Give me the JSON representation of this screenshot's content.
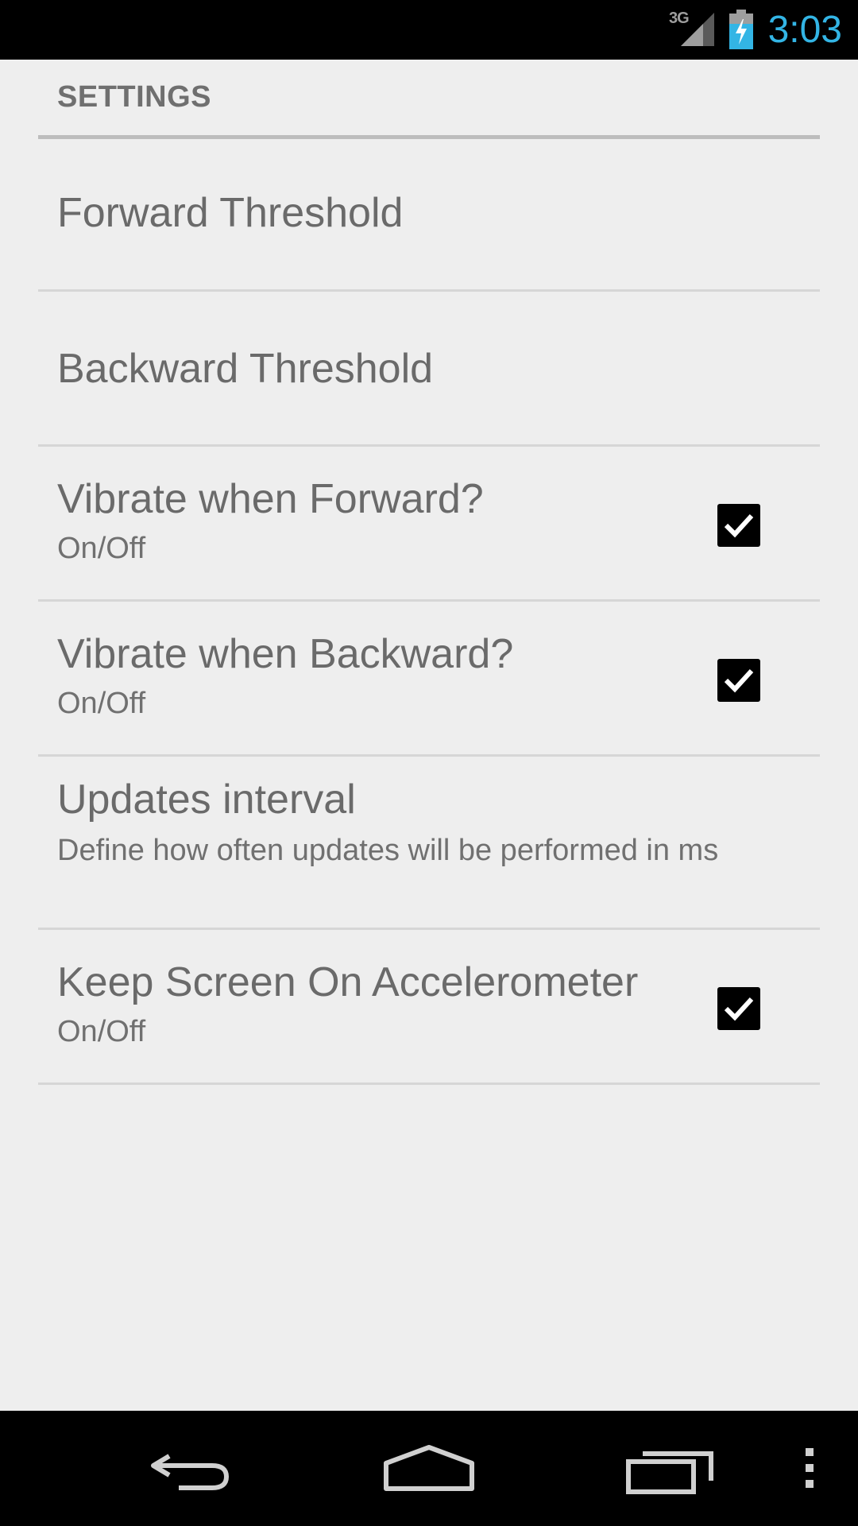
{
  "status_bar": {
    "network_type": "3G",
    "time": "3:03",
    "clock_color": "#33b5e5"
  },
  "settings": {
    "section_title": "SETTINGS",
    "items": [
      {
        "title": "Forward Threshold",
        "summary": "",
        "has_checkbox": false
      },
      {
        "title": "Backward Threshold",
        "summary": "",
        "has_checkbox": false
      },
      {
        "title": "Vibrate when Forward?",
        "summary": "On/Off",
        "has_checkbox": true,
        "checked": true
      },
      {
        "title": "Vibrate when Backward?",
        "summary": "On/Off",
        "has_checkbox": true,
        "checked": true
      },
      {
        "title": "Updates interval",
        "summary": "Define how often updates will be performed in ms",
        "has_checkbox": false
      },
      {
        "title": "Keep Screen On Accelerometer",
        "summary": "On/Off",
        "has_checkbox": true,
        "checked": true
      }
    ]
  },
  "nav_bar": {
    "icons": [
      "back-icon",
      "home-icon",
      "recent-apps-icon",
      "overflow-menu-icon"
    ]
  }
}
